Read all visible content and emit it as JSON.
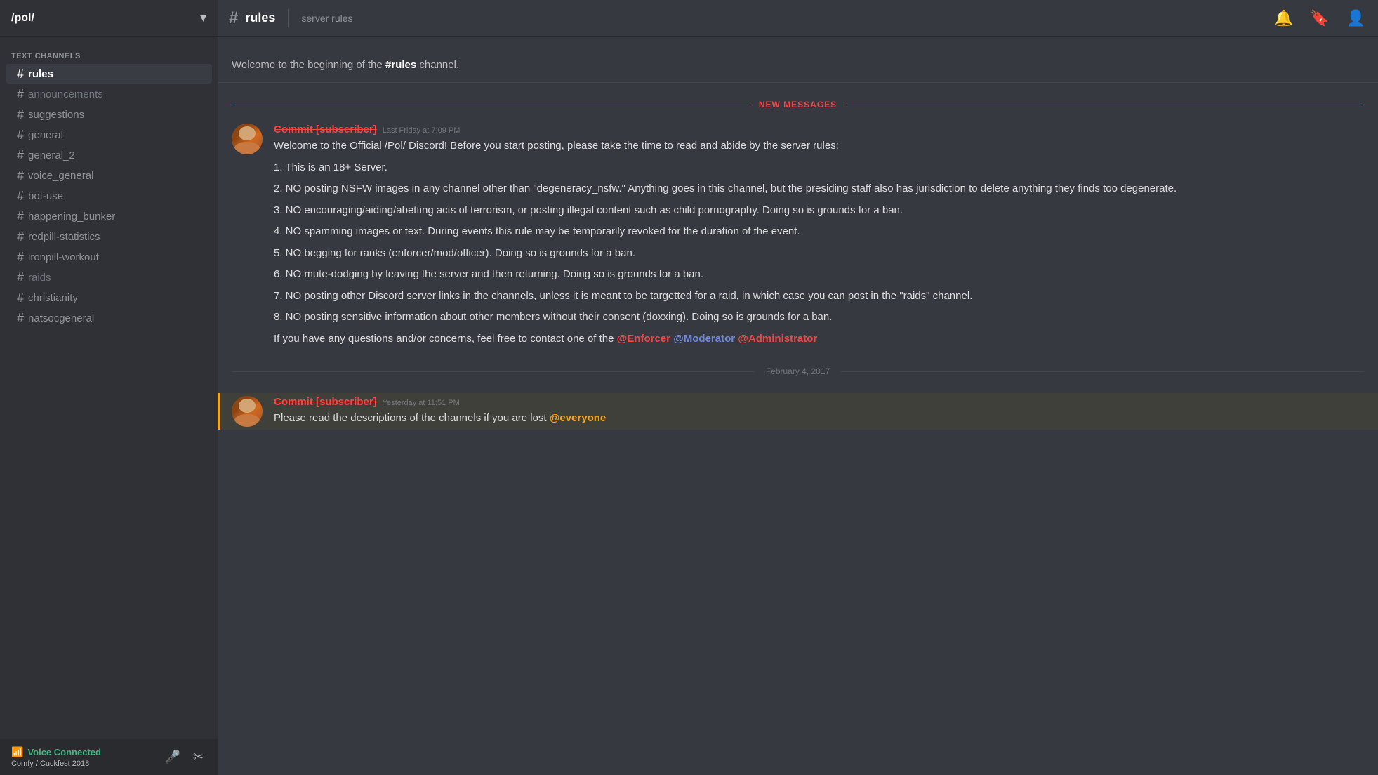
{
  "server": {
    "name": "/pol/",
    "chevron": "▾"
  },
  "sidebar": {
    "section_label": "TEXT CHANNELS",
    "channels": [
      {
        "id": "rules",
        "name": "rules",
        "active": true,
        "muted": false
      },
      {
        "id": "announcements",
        "name": "announcements",
        "active": false,
        "muted": true
      },
      {
        "id": "suggestions",
        "name": "suggestions",
        "active": false,
        "muted": false
      },
      {
        "id": "general",
        "name": "general",
        "active": false,
        "muted": false
      },
      {
        "id": "general_2",
        "name": "general_2",
        "active": false,
        "muted": false
      },
      {
        "id": "voice_general",
        "name": "voice_general",
        "active": false,
        "muted": false
      },
      {
        "id": "bot-use",
        "name": "bot-use",
        "active": false,
        "muted": false
      },
      {
        "id": "happening_bunker",
        "name": "happening_bunker",
        "active": false,
        "muted": false
      },
      {
        "id": "redpill-statistics",
        "name": "redpill-statistics",
        "active": false,
        "muted": false
      },
      {
        "id": "ironpill-workout",
        "name": "ironpill-workout",
        "active": false,
        "muted": false
      },
      {
        "id": "raids",
        "name": "raids",
        "active": false,
        "muted": true
      },
      {
        "id": "christianity",
        "name": "christianity",
        "active": false,
        "muted": false
      },
      {
        "id": "natsocgeneral",
        "name": "natsocgeneral",
        "active": false,
        "muted": false
      }
    ],
    "voice": {
      "status": "Voice Connected",
      "channel": "Comfy / Cuckfest 2018"
    }
  },
  "header": {
    "hash": "#",
    "channel_name": "rules",
    "topic": "server rules"
  },
  "messages": {
    "intro_text": "Welcome to the beginning of the ",
    "intro_channel": "#rules",
    "intro_end": " channel.",
    "new_messages_label": "NEW MESSAGES",
    "message1": {
      "username": "Commit [subscriber]",
      "timestamp": "Last Friday at 7:09 PM",
      "lines": [
        "Welcome to the Official /Pol/ Discord! Before you start posting, please take the time to read and abide by the server rules:",
        "1. This is an 18+ Server.",
        "2. NO posting NSFW images in any channel other than \"degeneracy_nsfw.\" Anything goes in this channel, but the presiding staff also has jurisdiction to delete anything they finds too degenerate.",
        "3. NO encouraging/aiding/abetting acts of terrorism, or posting illegal content such as child pornography. Doing so is grounds for a ban.",
        "4. NO spamming images or text. During events this rule may be temporarily revoked for the duration of the event.",
        "5. NO begging for ranks (enforcer/mod/officer). Doing so is grounds for a ban.",
        "6. NO mute-dodging by leaving the server and then returning. Doing so is grounds for a ban.",
        "7. NO posting other Discord server links in the channels, unless it is meant to be targetted for a raid, in which case you can post in the \"raids\" channel.",
        "8. NO posting sensitive information about other members without their consent (doxxing). Doing so is grounds for a ban.",
        "If you have any questions and/or concerns, feel free to contact one of the"
      ],
      "mention_enforcer": "@Enforcer",
      "mention_moderator": "@Moderator",
      "mention_administrator": "@Administrator"
    },
    "date_divider": "February 4, 2017",
    "message2": {
      "username": "Commit [subscriber]",
      "timestamp": "Yesterday at 11:51 PM",
      "text": "Please read the descriptions of the channels if you are lost ",
      "mention_everyone": "@everyone"
    }
  }
}
